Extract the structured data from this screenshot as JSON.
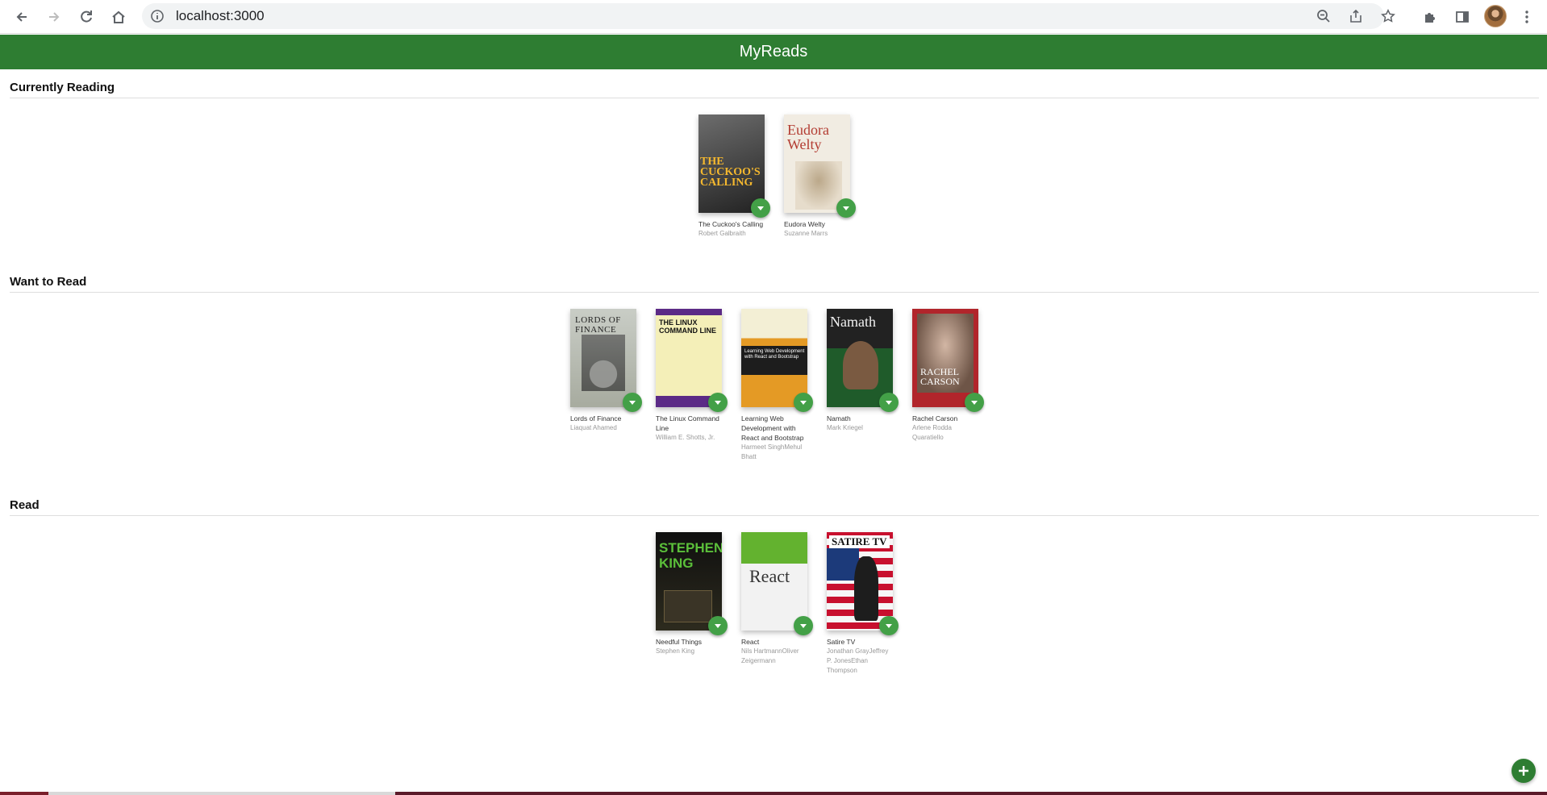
{
  "browser": {
    "url": "localhost:3000",
    "icons": [
      "back-arrow-icon",
      "forward-arrow-icon",
      "reload-icon",
      "home-icon",
      "info-icon",
      "zoom-out-icon",
      "share-icon",
      "star-icon",
      "extensions-icon",
      "side-panel-icon",
      "menu-dots-icon"
    ]
  },
  "app": {
    "title": "MyReads",
    "accent_color": "#2e7d32",
    "button_color": "#43a047"
  },
  "shelves": [
    {
      "title": "Currently Reading",
      "books": [
        {
          "title": "The Cuckoo's Calling",
          "authors": "Robert Galbraith"
        },
        {
          "title": "Eudora Welty",
          "authors": "Suzanne Marrs"
        }
      ]
    },
    {
      "title": "Want to Read",
      "books": [
        {
          "title": "Lords of Finance",
          "authors": "Liaquat Ahamed"
        },
        {
          "title": "The Linux Command Line",
          "authors": "William E. Shotts, Jr."
        },
        {
          "title": "Learning Web Development with React and Bootstrap",
          "authors": "Harmeet SinghMehul Bhatt"
        },
        {
          "title": "Namath",
          "authors": "Mark Kriegel"
        },
        {
          "title": "Rachel Carson",
          "authors": "Arlene Rodda Quaratiello"
        }
      ]
    },
    {
      "title": "Read",
      "books": [
        {
          "title": "Needful Things",
          "authors": "Stephen King"
        },
        {
          "title": "React",
          "authors": "Nils HartmannOliver Zeigermann"
        },
        {
          "title": "Satire TV",
          "authors": "Jonathan GrayJeffrey P. JonesEthan Thompson"
        }
      ]
    }
  ],
  "add_button_icon": "plus-icon"
}
